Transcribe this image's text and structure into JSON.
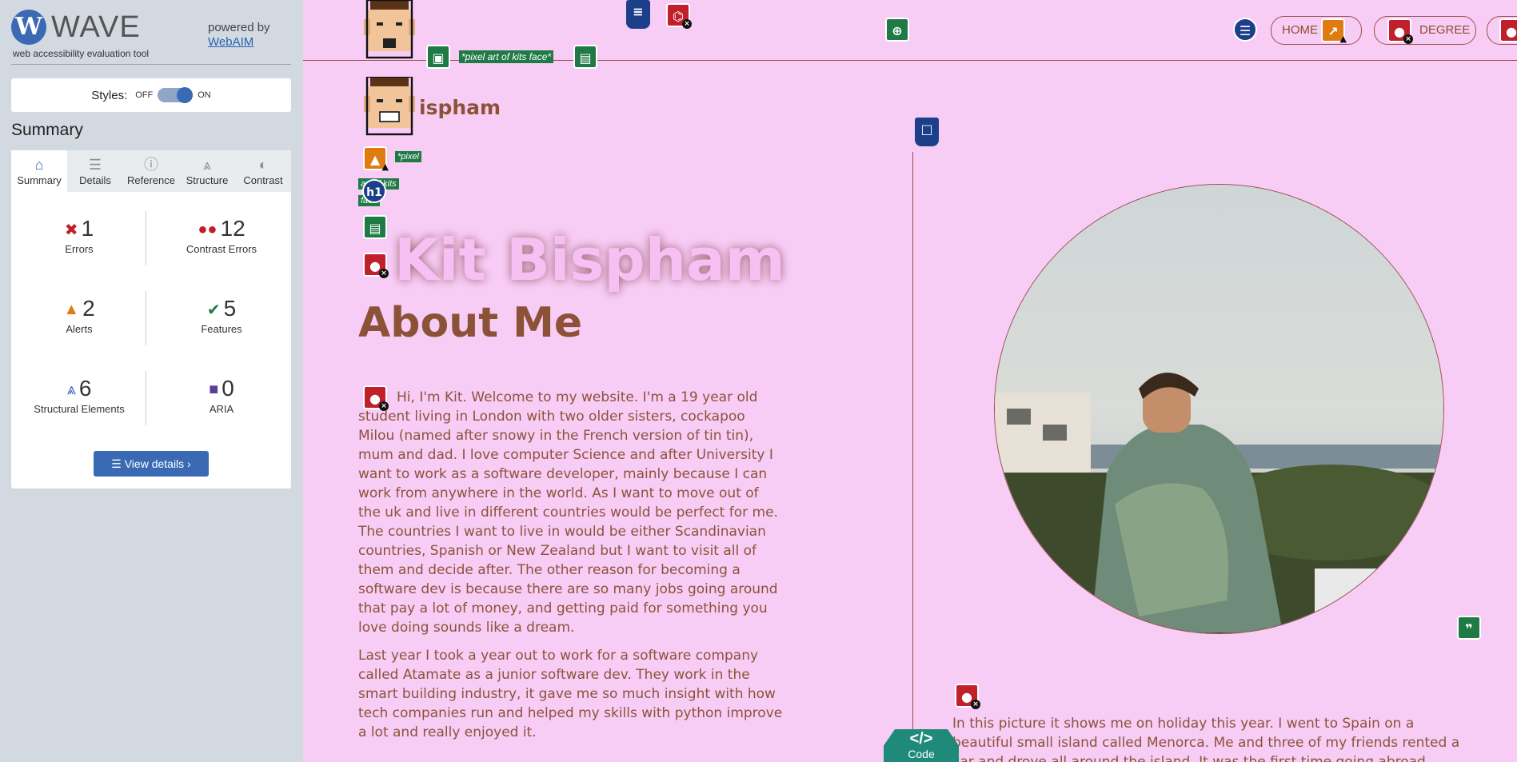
{
  "wave": {
    "logo_letter": "W",
    "logo_text": "WAVE",
    "subtitle": "web accessibility evaluation tool",
    "powered_by": "powered by",
    "powered_link": "WebAIM",
    "styles_label": "Styles:",
    "styles_off": "OFF",
    "styles_on": "ON",
    "summary_title": "Summary",
    "tabs": [
      {
        "label": "Summary",
        "icon": "home-icon"
      },
      {
        "label": "Details",
        "icon": "list-icon"
      },
      {
        "label": "Reference",
        "icon": "info-icon"
      },
      {
        "label": "Structure",
        "icon": "hierarchy-icon"
      },
      {
        "label": "Contrast",
        "icon": "contrast-icon"
      }
    ],
    "stats": {
      "errors": {
        "count": "1",
        "label": "Errors"
      },
      "contrast_errors": {
        "count": "12",
        "label": "Contrast Errors"
      },
      "alerts": {
        "count": "2",
        "label": "Alerts"
      },
      "features": {
        "count": "5",
        "label": "Features"
      },
      "structural": {
        "count": "6",
        "label": "Structural Elements"
      },
      "aria": {
        "count": "0",
        "label": "ARIA"
      }
    },
    "view_details": "View details ›"
  },
  "page": {
    "nav": {
      "home": "HOME",
      "degree": "DEGREE"
    },
    "alt_label_top": "*pixel art of kits face*",
    "alt_label_small_1": "*pixel",
    "alt_label_small_2": "art of kits",
    "alt_label_small_3": "face",
    "h1_badge": "h1",
    "small_name": "ispham",
    "title": "Kit Bispham",
    "about_heading": "About Me",
    "para1": "Hi, I'm Kit. Welcome to my website. I'm a 19 year old student living in London with two older sisters, cockapoo Milou (named after snowy in the French version of tin tin), mum and dad. I love computer Science and after University I want to work as a software developer, mainly because I can work from anywhere in the world. As I want to move out of the uk and live in different countries would be perfect for me. The countries I want to live in would be either Scandinavian countries, Spanish or New Zealand but I want to visit all of them and decide after. The other reason for becoming a software dev is because there are so many jobs going around that pay a lot of money, and getting paid for something you love doing sounds like a dream.",
    "para2": "Last year I took a year out to work for a software company called Atamate as a junior software dev. They work in the smart building industry, it gave me so much insight with how tech companies run and helped my skills with python improve a lot and really enjoyed it.",
    "caption": "In this picture it shows me on holiday this year. I went to Spain on a beautiful small island called Menorca. Me and three of my friends rented a car and drove all around the island. It was the first time going abroad without my family and I",
    "code_label": "Code",
    "code_symbol": "</>"
  },
  "colors": {
    "page_bg": "#f7cdf6",
    "text_brown": "#8c5238",
    "wave_blue": "#3a6ab4",
    "error_red": "#c0202a",
    "feature_green": "#1f7a45",
    "alert_orange": "#e07b12"
  }
}
